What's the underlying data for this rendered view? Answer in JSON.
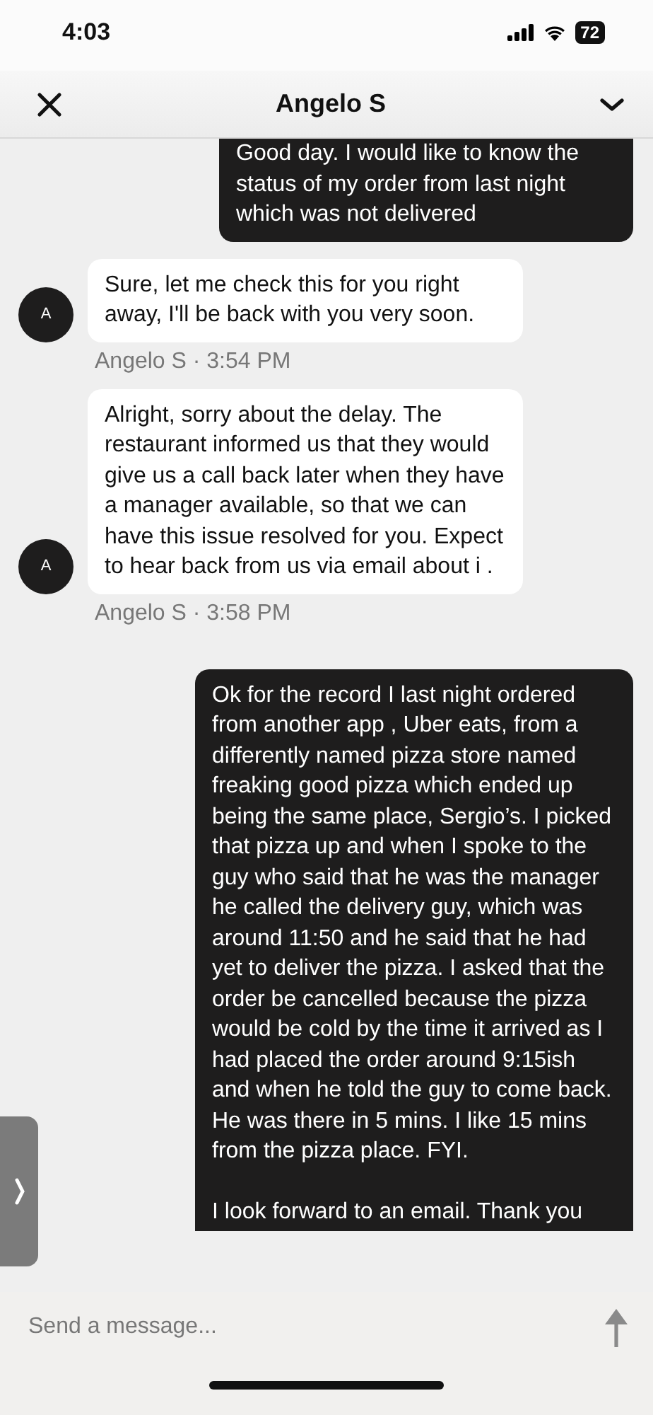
{
  "status_bar": {
    "time": "4:03",
    "battery": "72"
  },
  "header": {
    "title": "Angelo S"
  },
  "messages": [
    {
      "kind": "outgoing",
      "text": "Good day. I would like to know the status of my order from last night which was not delivered"
    },
    {
      "kind": "incoming",
      "avatar": "A",
      "text": "Sure, let me check this for you right away, I'll be back with you very soon.",
      "meta": "Angelo S · 3:54 PM"
    },
    {
      "kind": "incoming",
      "avatar": "A",
      "text": "Alright, sorry about the delay. The restaurant informed us that they would give us a call back later when they have a manager available, so that we can have this issue resolved for you. Expect to hear back from us via email about i .",
      "meta": "Angelo S · 3:58 PM"
    },
    {
      "kind": "outgoing",
      "text": "Ok for the record I last night ordered from another app , Uber eats, from a differently named pizza store named freaking good pizza which ended up being the same place, Sergio’s. I picked that pizza up and when I spoke to the guy who said that he was the manager he called the delivery guy, which was around 11:50 and he said that he had yet to deliver the pizza. I asked that the order be cancelled because the pizza would be cold by the time it arrived as I had placed the order around 9:15ish and when he told the guy to come back. He was there in 5 mins. I like 15 mins from the pizza place. FYI.\n\nI look forward to an email. Thank you"
    }
  ],
  "composer": {
    "placeholder": "Send a message..."
  }
}
